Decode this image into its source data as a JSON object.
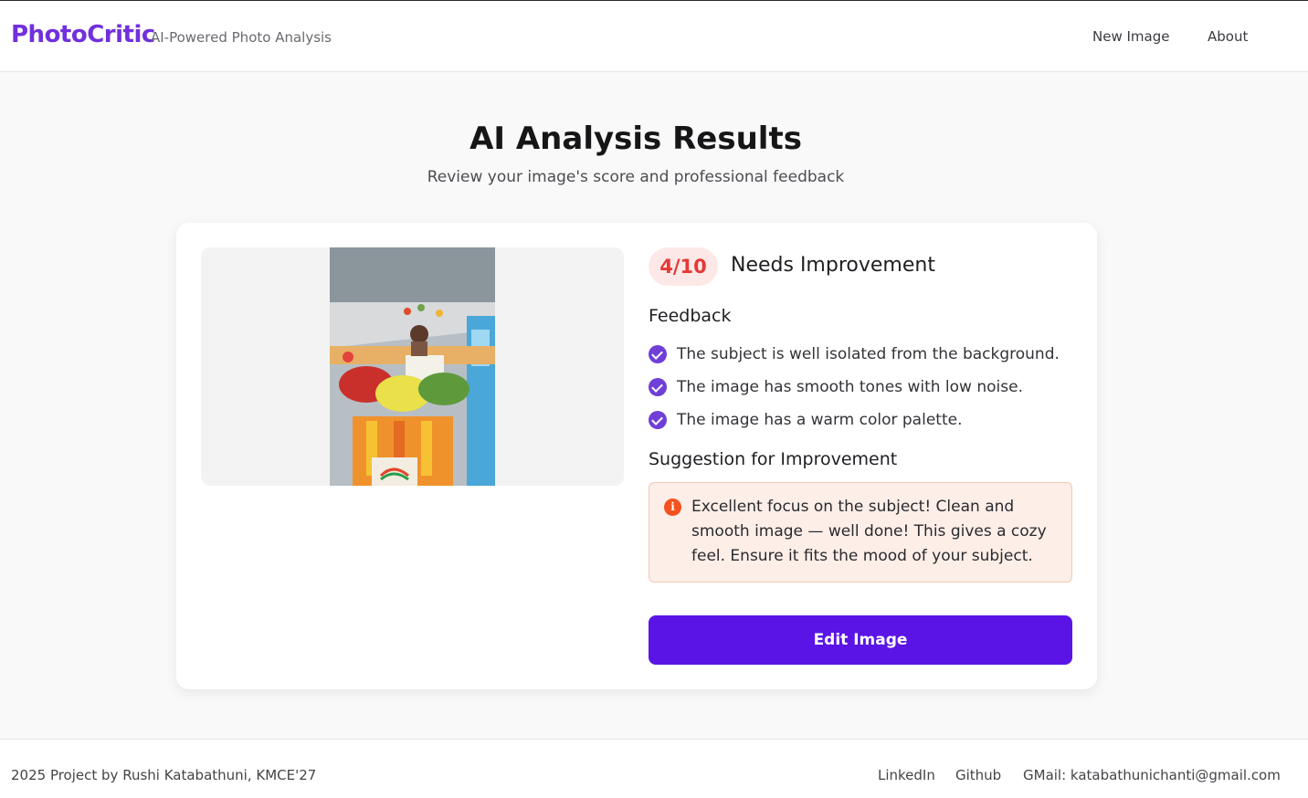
{
  "header": {
    "brand": "PhotoCritic",
    "tagline": "AI-Powered Photo Analysis",
    "nav": {
      "new_image": "New Image",
      "about": "About"
    }
  },
  "hero": {
    "title": "AI Analysis Results",
    "subtitle": "Review your image's score and professional feedback"
  },
  "result": {
    "score": "4/10",
    "score_label": "Needs Improvement",
    "score_color": "#e53935",
    "feedback_title": "Feedback",
    "feedback": [
      "The subject is well isolated from the background.",
      "The image has smooth tones with low noise.",
      "The image has a warm color palette."
    ],
    "suggestion_title": "Suggestion for Improvement",
    "suggestion": "Excellent focus on the subject! Clean and smooth image — well done! This gives a cozy feel. Ensure it fits the mood of your subject.",
    "edit_button": "Edit Image",
    "accent_color": "#5a14e6"
  },
  "footer": {
    "copyright": "2025 Project by Rushi Katabathuni, KMCE'27",
    "links": {
      "linkedin": "LinkedIn",
      "github": "Github",
      "gmail": "GMail: katabathunichanti@gmail.com"
    }
  }
}
